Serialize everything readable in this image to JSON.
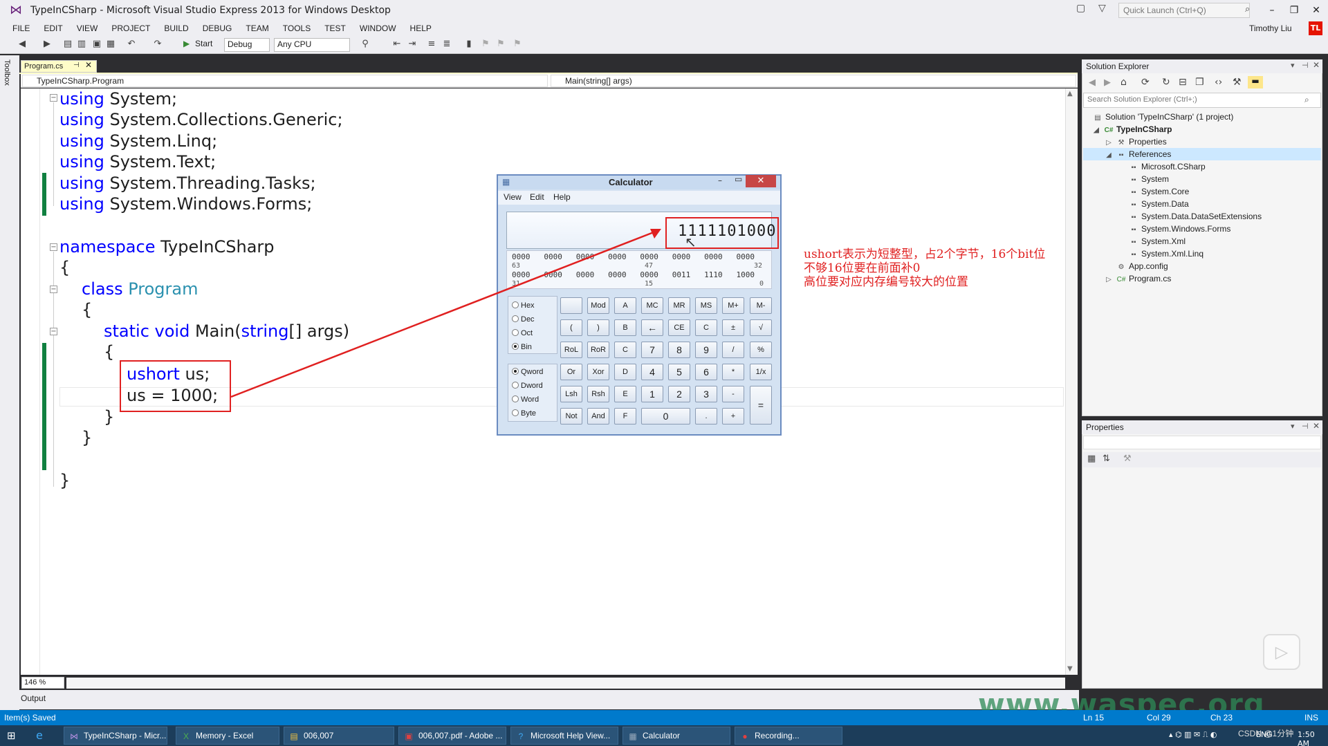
{
  "window": {
    "title": "TypeInCSharp - Microsoft Visual Studio Express 2013 for Windows Desktop",
    "quick_launch_placeholder": "Quick Launch (Ctrl+Q)",
    "user": "Timothy Liu",
    "user_initials": "TL"
  },
  "menu": [
    "FILE",
    "EDIT",
    "VIEW",
    "PROJECT",
    "BUILD",
    "DEBUG",
    "TEAM",
    "TOOLS",
    "TEST",
    "WINDOW",
    "HELP"
  ],
  "toolbar": {
    "start_label": "Start",
    "config": "Debug",
    "platform": "Any CPU"
  },
  "toolbox_label": "Toolbox",
  "editor": {
    "tab_name": "Program.cs",
    "nav_left": "TypeInCSharp.Program",
    "nav_right": "Main(string[] args)",
    "zoom": "146 %",
    "lines": [
      {
        "kw": "using",
        "rest": " System;"
      },
      {
        "kw": "using",
        "rest": " System.Collections.Generic;"
      },
      {
        "kw": "using",
        "rest": " System.Linq;"
      },
      {
        "kw": "using",
        "rest": " System.Text;"
      },
      {
        "kw": "using",
        "rest": " System.Threading.Tasks;"
      },
      {
        "kw": "using",
        "rest": " System.Windows.Forms;"
      }
    ],
    "namespace_kw": "namespace",
    "namespace_name": " TypeInCSharp",
    "open_brace": "{",
    "close_brace": "}",
    "class_kw": "class",
    "class_name": "Program",
    "static_kw": "static void",
    "main_sig_a": " Main(",
    "main_sig_kw": "string",
    "main_sig_b": "[] args)",
    "decl_kw": "ushort",
    "decl_rest": " us;",
    "assign": "us = 1000;"
  },
  "output_label": "Output",
  "solution_explorer": {
    "title": "Solution Explorer",
    "search_placeholder": "Search Solution Explorer (Ctrl+;)",
    "items": [
      {
        "label": "Solution 'TypeInCSharp' (1 project)",
        "icon": "solution-icon"
      },
      {
        "label": "TypeInCSharp",
        "icon": "csharp-project-icon"
      },
      {
        "label": "Properties",
        "icon": "wrench-icon"
      },
      {
        "label": "References",
        "icon": "references-icon"
      },
      {
        "label": "Microsoft.CSharp",
        "icon": "reference-icon"
      },
      {
        "label": "System",
        "icon": "reference-icon"
      },
      {
        "label": "System.Core",
        "icon": "reference-icon"
      },
      {
        "label": "System.Data",
        "icon": "reference-icon"
      },
      {
        "label": "System.Data.DataSetExtensions",
        "icon": "reference-icon"
      },
      {
        "label": "System.Windows.Forms",
        "icon": "reference-icon"
      },
      {
        "label": "System.Xml",
        "icon": "reference-icon"
      },
      {
        "label": "System.Xml.Linq",
        "icon": "reference-icon"
      },
      {
        "label": "App.config",
        "icon": "config-icon"
      },
      {
        "label": "Program.cs",
        "icon": "csharp-file-icon"
      }
    ]
  },
  "properties": {
    "title": "Properties"
  },
  "statusbar": {
    "message": "Item(s) Saved",
    "line": "Ln 15",
    "col": "Col 29",
    "ch": "Ch 23",
    "mode": "INS"
  },
  "taskbar": [
    {
      "label": "TypeInCSharp - Micr...",
      "icon": "vs-icon"
    },
    {
      "label": "Memory - Excel",
      "icon": "excel-icon"
    },
    {
      "label": "006,007",
      "icon": "folder-icon"
    },
    {
      "label": "006,007.pdf - Adobe ...",
      "icon": "pdf-icon"
    },
    {
      "label": "Microsoft Help View...",
      "icon": "help-icon"
    },
    {
      "label": "Calculator",
      "icon": "calculator-icon"
    },
    {
      "label": "Recording...",
      "icon": "recording-icon"
    }
  ],
  "tray": {
    "lang": "ENG",
    "time": "1:50 AM"
  },
  "calculator": {
    "title": "Calculator",
    "menu": [
      "View",
      "Edit",
      "Help"
    ],
    "display": "1111101000",
    "bits_row1": "0000   0000   0000   0000   0000   0000   0000   0000",
    "bits_idx1_left": "63",
    "bits_idx1_mid": "47",
    "bits_idx1_right": "32",
    "bits_row2": "0000   0000   0000   0000   0000   0011   1110   1000",
    "bits_idx2_left": "31",
    "bits_idx2_mid": "15",
    "bits_idx2_right": "0",
    "base_options": [
      {
        "label": "Hex",
        "checked": false
      },
      {
        "label": "Dec",
        "checked": false
      },
      {
        "label": "Oct",
        "checked": false
      },
      {
        "label": "Bin",
        "checked": true
      }
    ],
    "word_options": [
      {
        "label": "Qword",
        "checked": true
      },
      {
        "label": "Dword",
        "checked": false
      },
      {
        "label": "Word",
        "checked": false
      },
      {
        "label": "Byte",
        "checked": false
      }
    ],
    "buttons": [
      [
        "",
        "Mod",
        "A",
        "MC",
        "MR",
        "MS",
        "M+",
        "M-"
      ],
      [
        "(",
        ")",
        "B",
        "←",
        "CE",
        "C",
        "±",
        "√"
      ],
      [
        "RoL",
        "RoR",
        "C",
        "7",
        "8",
        "9",
        "/",
        "%"
      ],
      [
        "Or",
        "Xor",
        "D",
        "4",
        "5",
        "6",
        "*",
        "1/x"
      ],
      [
        "Lsh",
        "Rsh",
        "E",
        "1",
        "2",
        "3",
        "-",
        "="
      ],
      [
        "Not",
        "And",
        "F",
        "0",
        "",
        ".",
        "+",
        ""
      ]
    ]
  },
  "annotation": {
    "line1": "ushort表示为短整型，占2个字节，16个bit位",
    "line2": "不够16位要在前面补0",
    "line3": "高位要对应内存编号较大的位置"
  },
  "watermark": "www.waspec.org",
  "csdn_mark": "CSDN @1分钟"
}
